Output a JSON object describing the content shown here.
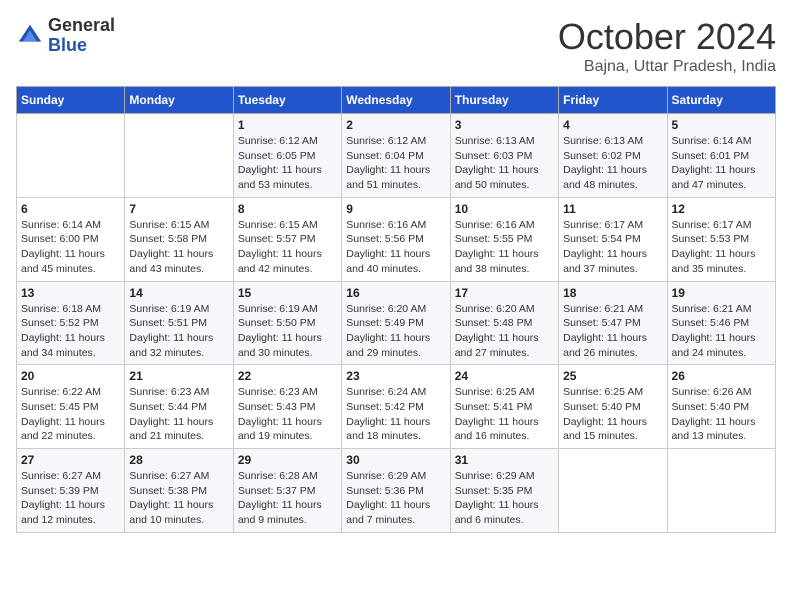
{
  "header": {
    "logo_general": "General",
    "logo_blue": "Blue",
    "month": "October 2024",
    "location": "Bajna, Uttar Pradesh, India"
  },
  "days_of_week": [
    "Sunday",
    "Monday",
    "Tuesday",
    "Wednesday",
    "Thursday",
    "Friday",
    "Saturday"
  ],
  "weeks": [
    [
      {
        "day": "",
        "info": ""
      },
      {
        "day": "",
        "info": ""
      },
      {
        "day": "1",
        "sunrise": "Sunrise: 6:12 AM",
        "sunset": "Sunset: 6:05 PM",
        "daylight": "Daylight: 11 hours and 53 minutes."
      },
      {
        "day": "2",
        "sunrise": "Sunrise: 6:12 AM",
        "sunset": "Sunset: 6:04 PM",
        "daylight": "Daylight: 11 hours and 51 minutes."
      },
      {
        "day": "3",
        "sunrise": "Sunrise: 6:13 AM",
        "sunset": "Sunset: 6:03 PM",
        "daylight": "Daylight: 11 hours and 50 minutes."
      },
      {
        "day": "4",
        "sunrise": "Sunrise: 6:13 AM",
        "sunset": "Sunset: 6:02 PM",
        "daylight": "Daylight: 11 hours and 48 minutes."
      },
      {
        "day": "5",
        "sunrise": "Sunrise: 6:14 AM",
        "sunset": "Sunset: 6:01 PM",
        "daylight": "Daylight: 11 hours and 47 minutes."
      }
    ],
    [
      {
        "day": "6",
        "sunrise": "Sunrise: 6:14 AM",
        "sunset": "Sunset: 6:00 PM",
        "daylight": "Daylight: 11 hours and 45 minutes."
      },
      {
        "day": "7",
        "sunrise": "Sunrise: 6:15 AM",
        "sunset": "Sunset: 5:58 PM",
        "daylight": "Daylight: 11 hours and 43 minutes."
      },
      {
        "day": "8",
        "sunrise": "Sunrise: 6:15 AM",
        "sunset": "Sunset: 5:57 PM",
        "daylight": "Daylight: 11 hours and 42 minutes."
      },
      {
        "day": "9",
        "sunrise": "Sunrise: 6:16 AM",
        "sunset": "Sunset: 5:56 PM",
        "daylight": "Daylight: 11 hours and 40 minutes."
      },
      {
        "day": "10",
        "sunrise": "Sunrise: 6:16 AM",
        "sunset": "Sunset: 5:55 PM",
        "daylight": "Daylight: 11 hours and 38 minutes."
      },
      {
        "day": "11",
        "sunrise": "Sunrise: 6:17 AM",
        "sunset": "Sunset: 5:54 PM",
        "daylight": "Daylight: 11 hours and 37 minutes."
      },
      {
        "day": "12",
        "sunrise": "Sunrise: 6:17 AM",
        "sunset": "Sunset: 5:53 PM",
        "daylight": "Daylight: 11 hours and 35 minutes."
      }
    ],
    [
      {
        "day": "13",
        "sunrise": "Sunrise: 6:18 AM",
        "sunset": "Sunset: 5:52 PM",
        "daylight": "Daylight: 11 hours and 34 minutes."
      },
      {
        "day": "14",
        "sunrise": "Sunrise: 6:19 AM",
        "sunset": "Sunset: 5:51 PM",
        "daylight": "Daylight: 11 hours and 32 minutes."
      },
      {
        "day": "15",
        "sunrise": "Sunrise: 6:19 AM",
        "sunset": "Sunset: 5:50 PM",
        "daylight": "Daylight: 11 hours and 30 minutes."
      },
      {
        "day": "16",
        "sunrise": "Sunrise: 6:20 AM",
        "sunset": "Sunset: 5:49 PM",
        "daylight": "Daylight: 11 hours and 29 minutes."
      },
      {
        "day": "17",
        "sunrise": "Sunrise: 6:20 AM",
        "sunset": "Sunset: 5:48 PM",
        "daylight": "Daylight: 11 hours and 27 minutes."
      },
      {
        "day": "18",
        "sunrise": "Sunrise: 6:21 AM",
        "sunset": "Sunset: 5:47 PM",
        "daylight": "Daylight: 11 hours and 26 minutes."
      },
      {
        "day": "19",
        "sunrise": "Sunrise: 6:21 AM",
        "sunset": "Sunset: 5:46 PM",
        "daylight": "Daylight: 11 hours and 24 minutes."
      }
    ],
    [
      {
        "day": "20",
        "sunrise": "Sunrise: 6:22 AM",
        "sunset": "Sunset: 5:45 PM",
        "daylight": "Daylight: 11 hours and 22 minutes."
      },
      {
        "day": "21",
        "sunrise": "Sunrise: 6:23 AM",
        "sunset": "Sunset: 5:44 PM",
        "daylight": "Daylight: 11 hours and 21 minutes."
      },
      {
        "day": "22",
        "sunrise": "Sunrise: 6:23 AM",
        "sunset": "Sunset: 5:43 PM",
        "daylight": "Daylight: 11 hours and 19 minutes."
      },
      {
        "day": "23",
        "sunrise": "Sunrise: 6:24 AM",
        "sunset": "Sunset: 5:42 PM",
        "daylight": "Daylight: 11 hours and 18 minutes."
      },
      {
        "day": "24",
        "sunrise": "Sunrise: 6:25 AM",
        "sunset": "Sunset: 5:41 PM",
        "daylight": "Daylight: 11 hours and 16 minutes."
      },
      {
        "day": "25",
        "sunrise": "Sunrise: 6:25 AM",
        "sunset": "Sunset: 5:40 PM",
        "daylight": "Daylight: 11 hours and 15 minutes."
      },
      {
        "day": "26",
        "sunrise": "Sunrise: 6:26 AM",
        "sunset": "Sunset: 5:40 PM",
        "daylight": "Daylight: 11 hours and 13 minutes."
      }
    ],
    [
      {
        "day": "27",
        "sunrise": "Sunrise: 6:27 AM",
        "sunset": "Sunset: 5:39 PM",
        "daylight": "Daylight: 11 hours and 12 minutes."
      },
      {
        "day": "28",
        "sunrise": "Sunrise: 6:27 AM",
        "sunset": "Sunset: 5:38 PM",
        "daylight": "Daylight: 11 hours and 10 minutes."
      },
      {
        "day": "29",
        "sunrise": "Sunrise: 6:28 AM",
        "sunset": "Sunset: 5:37 PM",
        "daylight": "Daylight: 11 hours and 9 minutes."
      },
      {
        "day": "30",
        "sunrise": "Sunrise: 6:29 AM",
        "sunset": "Sunset: 5:36 PM",
        "daylight": "Daylight: 11 hours and 7 minutes."
      },
      {
        "day": "31",
        "sunrise": "Sunrise: 6:29 AM",
        "sunset": "Sunset: 5:35 PM",
        "daylight": "Daylight: 11 hours and 6 minutes."
      },
      {
        "day": "",
        "info": ""
      },
      {
        "day": "",
        "info": ""
      }
    ]
  ]
}
